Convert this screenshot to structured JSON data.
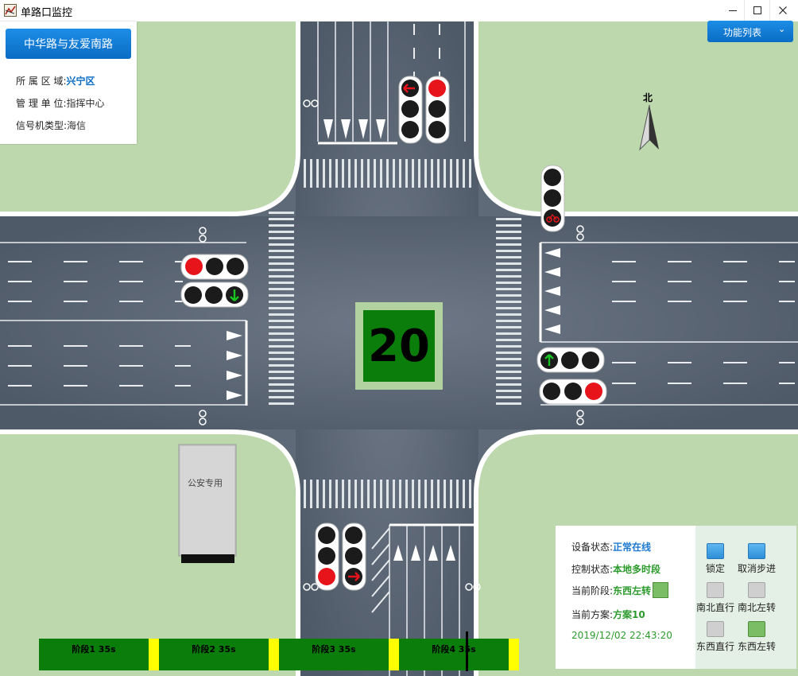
{
  "window": {
    "title": "单路口监控",
    "minimize_icon": "minimize-icon",
    "maximize_icon": "maximize-icon",
    "close_icon": "close-icon"
  },
  "location": {
    "name": "中华路与友爱南路",
    "area_label": "所 属 区 域:",
    "area_value": "兴宁区",
    "unit_label": "管 理 单 位:",
    "unit_value": "指挥中心",
    "type_label": "信号机类型:",
    "type_value": "海信"
  },
  "function_menu": {
    "label": "功能列表",
    "caret_icon": "chevron-down-icon"
  },
  "compass": {
    "label": "北"
  },
  "booth": {
    "label": "公安专用"
  },
  "countdown": {
    "value": "20"
  },
  "status": {
    "device_label": "设备状态:",
    "device_value": "正常在线",
    "control_label": "控制状态:",
    "control_value": "本地多时段",
    "phase_label": "当前阶段:",
    "phase_value": "东西左转",
    "plan_label": "当前方案:",
    "plan_value": "方案10",
    "datetime": "2019/12/02 22:43:20"
  },
  "controls": [
    {
      "label": "锁定",
      "icon": "lock-icon",
      "style": "blue"
    },
    {
      "label": "取消步进",
      "icon": "cancel-step-icon",
      "style": "blue"
    },
    {
      "label": "南北直行",
      "icon": "south-north-straight-icon",
      "style": "grey"
    },
    {
      "label": "南北左转",
      "icon": "south-north-left-icon",
      "style": "grey"
    },
    {
      "label": "东西直行",
      "icon": "east-west-straight-icon",
      "style": "grey"
    },
    {
      "label": "东西左转",
      "icon": "east-west-left-icon",
      "style": "green"
    }
  ],
  "phases": [
    {
      "label": "阶段1 35s"
    },
    {
      "label": "阶段2 35s"
    },
    {
      "label": "阶段3 35s"
    },
    {
      "label": "阶段4 35s"
    }
  ],
  "colors": {
    "accent": "#0b6cc4",
    "grass": "#bcd8ac",
    "road": "#5e6a78",
    "phase_green": "#0a7d0a",
    "phase_yellow": "#ffff00",
    "light_red": "#e8141c",
    "light_green": "#18c322"
  }
}
